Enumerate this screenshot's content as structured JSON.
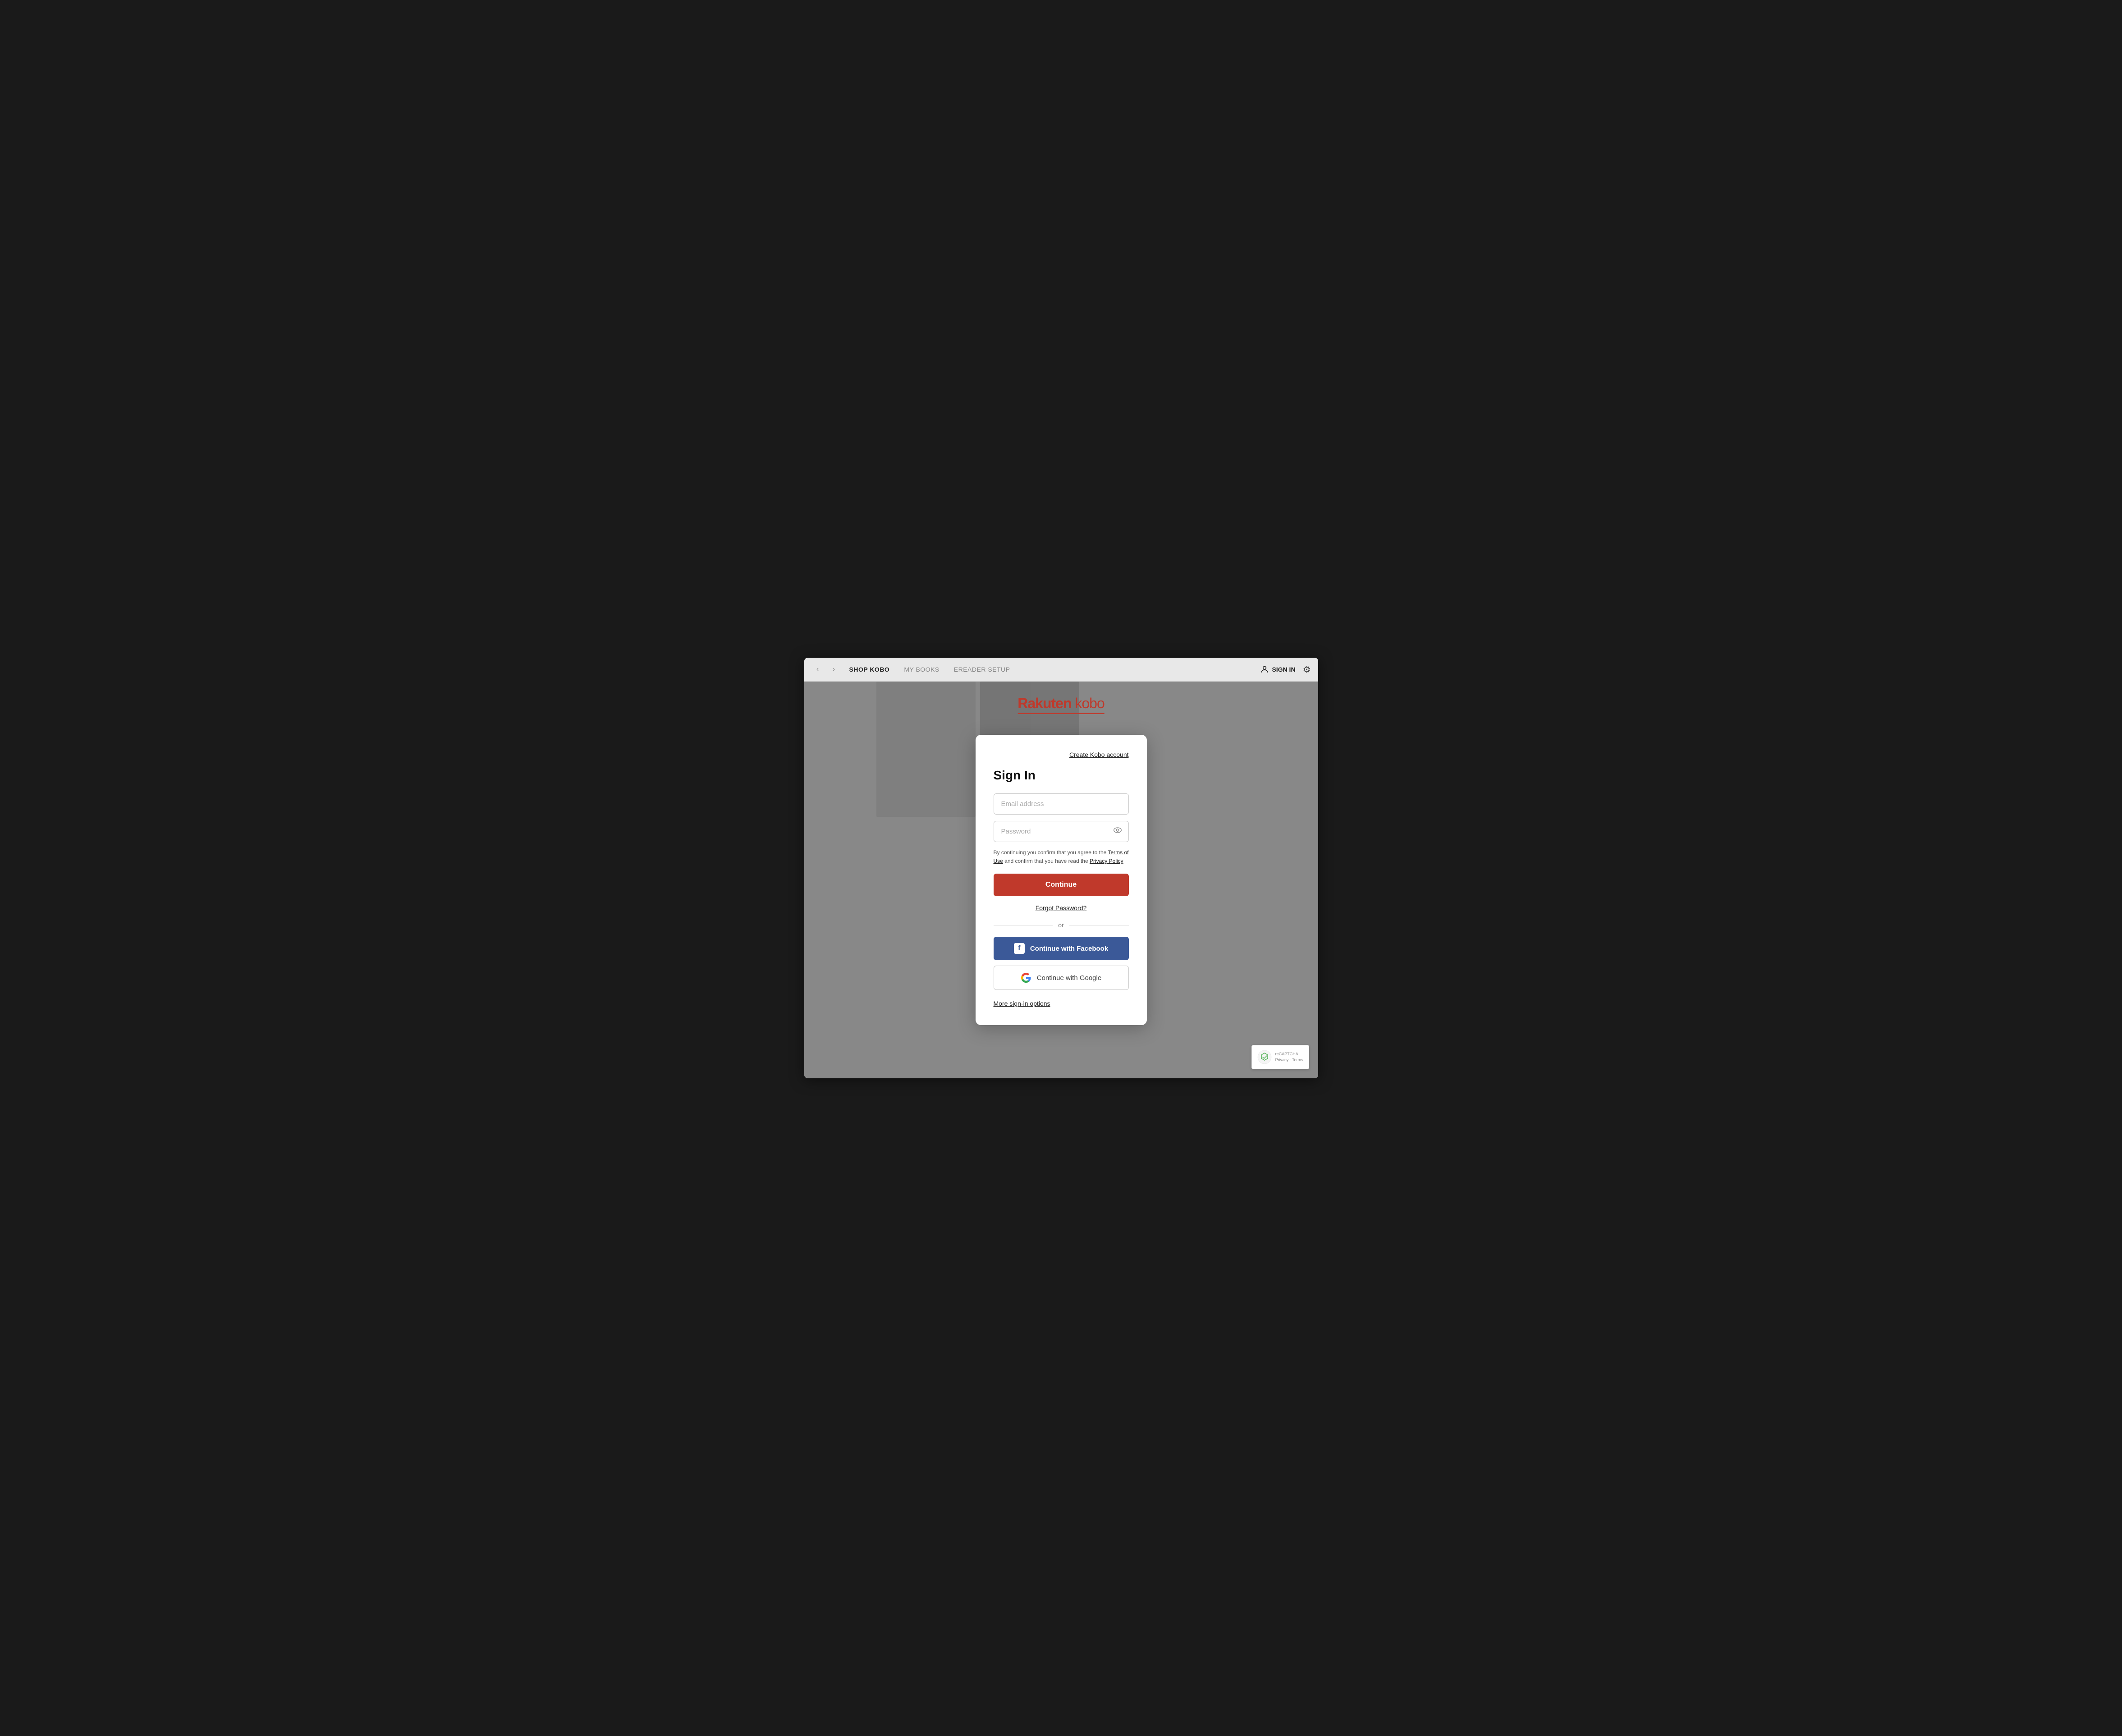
{
  "browser": {
    "back_button": "‹",
    "forward_button": "›",
    "nav": {
      "shop": "SHOP KOBO",
      "mybooks": "MY BOOKS",
      "ereader": "EREADER SETUP"
    },
    "sign_in_label": "SIGN IN",
    "settings_icon": "⚙"
  },
  "logo": {
    "text_rakuten": "Rakuten",
    "text_kobo": "kobo"
  },
  "modal": {
    "create_account_link": "Create Kobo account",
    "title": "Sign In",
    "email_placeholder": "Email address",
    "password_placeholder": "Password",
    "terms_text_1": "By continuing you confirm that you agree to the ",
    "terms_link_1": "Terms of Use",
    "terms_text_2": " and confirm that you have read the ",
    "terms_link_2": "Privacy Policy",
    "continue_label": "Continue",
    "forgot_password": "Forgot Password?",
    "divider_or": "or",
    "facebook_btn": "Continue with Facebook",
    "google_btn": "Continue with Google",
    "more_options": "More sign-in options"
  },
  "recaptcha": {
    "line1": "Privacy - Terms"
  }
}
